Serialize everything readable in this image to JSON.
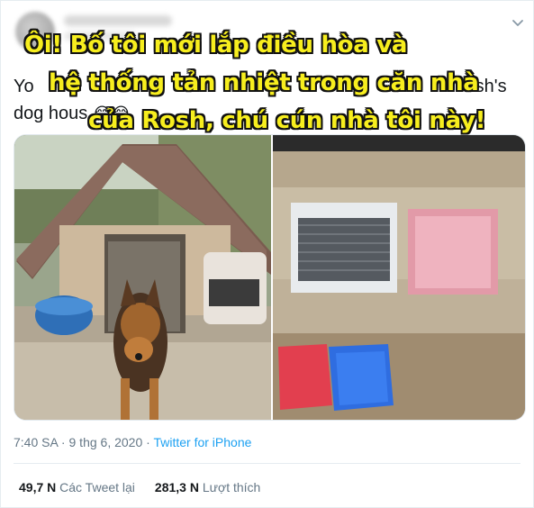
{
  "tweet": {
    "text_start": "Yo",
    "text_mid": "sh's",
    "text_line2": "dog hous",
    "emoji": "😂😂",
    "overlay_lines": [
      "Ôi! Bố tôi mới lắp điều hòa và",
      "hệ thống tản nhiệt trong căn nhà",
      "của Rosh, chú cún nhà tôi này!"
    ],
    "time": "7:40 SA",
    "separator": " · ",
    "date": "9 thg 6, 2020",
    "client": "Twitter for iPhone",
    "retweets_count": "49,7 N",
    "retweets_label": "Các Tweet lại",
    "likes_count": "281,3 N",
    "likes_label": "Lượt thích"
  },
  "icons": {
    "menu": "chevron-down-icon"
  },
  "colors": {
    "link": "#1da1f2",
    "overlay_text": "#f7ee1e",
    "muted": "#657786"
  }
}
